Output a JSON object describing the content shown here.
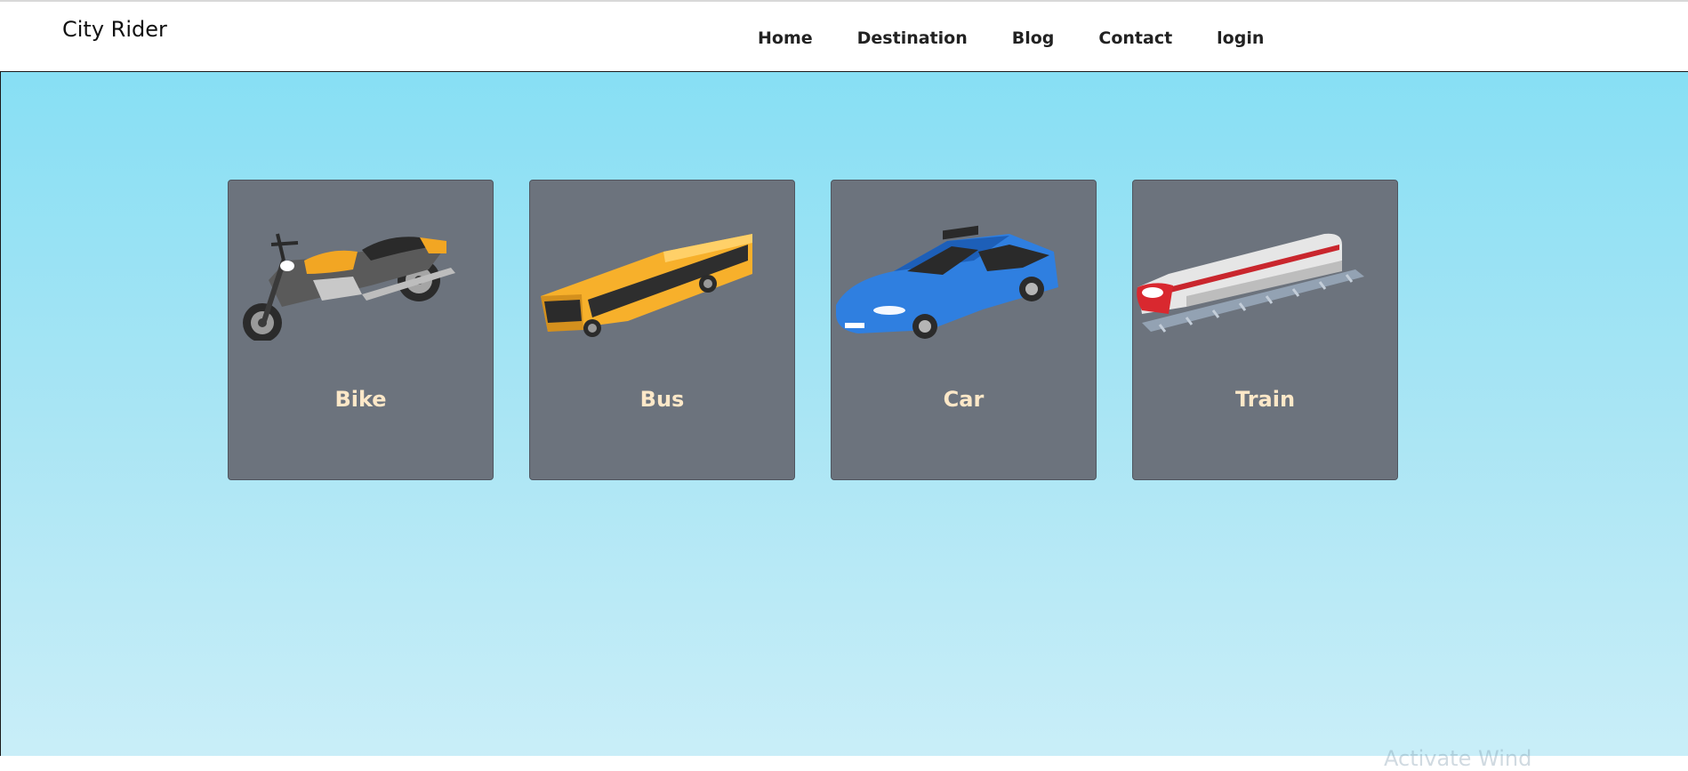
{
  "header": {
    "brand": "City Rider",
    "nav": [
      "Home",
      "Destination",
      "Blog",
      "Contact",
      "login"
    ]
  },
  "cards": [
    {
      "label": "Bike",
      "icon": "motorcycle-icon"
    },
    {
      "label": "Bus",
      "icon": "bus-icon"
    },
    {
      "label": "Car",
      "icon": "car-icon"
    },
    {
      "label": "Train",
      "icon": "train-icon"
    }
  ],
  "watermark": "Activate Wind",
  "colors": {
    "card_bg": "#6c737d",
    "card_label": "#fde8c8",
    "hero_top": "#87dff4",
    "hero_bottom": "#c9eef8",
    "bike_accent": "#f2a623",
    "bus_body": "#f7b02b",
    "car_body": "#2f7fe0",
    "train_accent": "#d9282f"
  }
}
